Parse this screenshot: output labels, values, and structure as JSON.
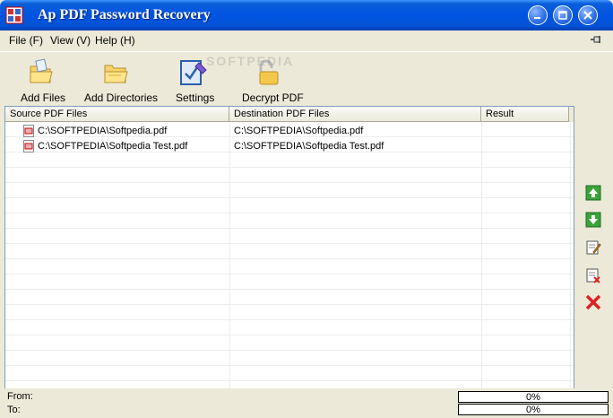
{
  "window": {
    "title": "Ap PDF Password Recovery"
  },
  "menu": [
    {
      "label": "File (F)"
    },
    {
      "label": "View (V)"
    },
    {
      "label": "Help (H)"
    }
  ],
  "toolbar": {
    "add_files": "Add Files",
    "add_directories": "Add Directories",
    "settings": "Settings",
    "decrypt_pdf": "Decrypt PDF"
  },
  "watermark": "SOFTPEDIA",
  "list": {
    "columns": [
      "Source PDF Files",
      "Destination PDF Files",
      "Result"
    ],
    "rows": [
      {
        "source": "C:\\SOFTPEDIA\\Softpedia.pdf",
        "destination": "C:\\SOFTPEDIA\\Softpedia.pdf",
        "result": ""
      },
      {
        "source": "C:\\SOFTPEDIA\\Softpedia Test.pdf",
        "destination": "C:\\SOFTPEDIA\\Softpedia Test.pdf",
        "result": ""
      }
    ]
  },
  "side_buttons": [
    "move-up-icon",
    "move-down-icon",
    "edit-icon",
    "remove-icon",
    "clear-icon"
  ],
  "status": {
    "from_label": "From:",
    "to_label": "To:",
    "from_progress": "0%",
    "to_progress": "0%",
    "from_progress_value": 0,
    "to_progress_value": 0
  }
}
